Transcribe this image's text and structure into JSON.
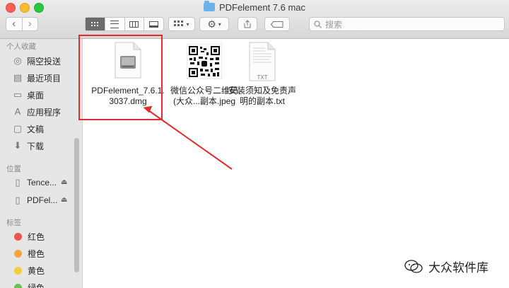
{
  "window": {
    "title": "PDFelement 7.6 mac"
  },
  "toolbar": {
    "back_icon": "chevron-left-icon",
    "forward_icon": "chevron-right-icon",
    "search_placeholder": "搜索",
    "arrange_icon": "arrange-grid-icon",
    "action_icon": "gear-icon",
    "share_icon": "share-icon",
    "tag_icon": "tag-icon"
  },
  "sidebar": {
    "favorites_header": "个人收藏",
    "favorites": [
      {
        "label": "隔空投送",
        "icon": "airdrop-icon"
      },
      {
        "label": "最近项目",
        "icon": "recents-icon"
      },
      {
        "label": "桌面",
        "icon": "desktop-icon"
      },
      {
        "label": "应用程序",
        "icon": "applications-icon"
      },
      {
        "label": "文稿",
        "icon": "documents-icon"
      },
      {
        "label": "下载",
        "icon": "downloads-icon"
      }
    ],
    "locations_header": "位置",
    "locations": [
      {
        "label": "Tence...",
        "icon": "disk-icon"
      },
      {
        "label": "PDFel...",
        "icon": "disk-icon"
      }
    ],
    "tags_header": "标签",
    "tags": [
      {
        "label": "红色",
        "color": "#f0524a"
      },
      {
        "label": "橙色",
        "color": "#f5a43a"
      },
      {
        "label": "黄色",
        "color": "#f7cc3a"
      },
      {
        "label": "绿色",
        "color": "#5fc454"
      }
    ]
  },
  "files": [
    {
      "name_line1": "PDFelement_7.6.1.",
      "name_line2": "3037.dmg",
      "icon": "dmg-disk-image-icon",
      "selected": true
    },
    {
      "name_line1": "微信公众号二维码",
      "name_line2": "(大众...副本.jpeg",
      "icon": "qr-code-image-icon",
      "selected": false
    },
    {
      "name_line1": "安装须知及免责声",
      "name_line2": "明的副本.txt",
      "icon": "txt-document-icon",
      "badge": "TXT",
      "selected": false
    }
  ],
  "watermark": {
    "text": "大众软件库",
    "icon": "wechat-icon"
  },
  "colors": {
    "annotation": "#e02c2c",
    "selection_highlight": "#6b6b6b"
  }
}
